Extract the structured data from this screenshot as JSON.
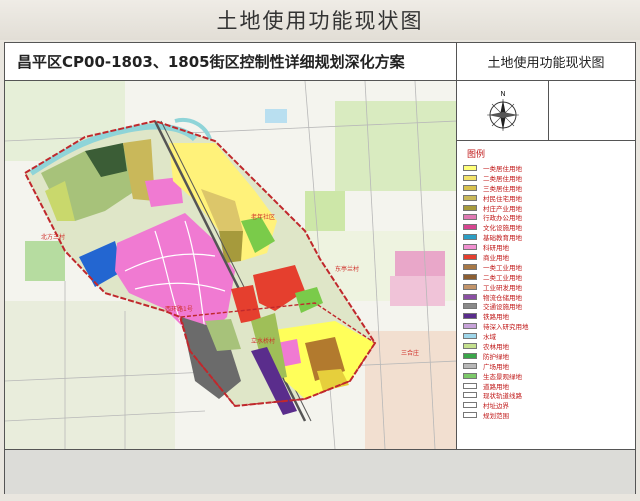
{
  "page_title": "土地使用功能现状图",
  "header": {
    "plan_title": "昌平区CP00-1803、1805街区控制性详细规划深化方案",
    "panel_title": "土地使用功能现状图"
  },
  "compass": {
    "north_letter": "N",
    "icon": "north-arrow-compass-icon"
  },
  "map": {
    "labels": [
      "北方三村",
      "西环路1号",
      "老年社区",
      "东亭兰村",
      "立水桥村",
      "三合庄"
    ]
  },
  "legend": {
    "title": "图例",
    "items": [
      {
        "label": "一类居住用地",
        "color": "#ffff7a"
      },
      {
        "label": "二类居住用地",
        "color": "#f2e26a"
      },
      {
        "label": "三类居住用地",
        "color": "#d7c14e"
      },
      {
        "label": "村民住宅用地",
        "color": "#c9b85a"
      },
      {
        "label": "村庄产业用地",
        "color": "#a69a3c"
      },
      {
        "label": "行政办公用地",
        "color": "#e07ab4"
      },
      {
        "label": "文化设施用地",
        "color": "#d64590"
      },
      {
        "label": "基础教育用地",
        "color": "#2c9ec4"
      },
      {
        "label": "科研用地",
        "color": "#f090d0"
      },
      {
        "label": "商业用地",
        "color": "#e53f2e"
      },
      {
        "label": "一类工业用地",
        "color": "#a77846"
      },
      {
        "label": "二类工业用地",
        "color": "#8c5e32"
      },
      {
        "label": "工业研发用地",
        "color": "#c2946a"
      },
      {
        "label": "物流仓储用地",
        "color": "#8a4fa3"
      },
      {
        "label": "交通设施用地",
        "color": "#8a8a8a"
      },
      {
        "label": "铁路用地",
        "color": "#5a2d8c"
      },
      {
        "label": "待深入研究用地",
        "color": "#c7a3d9"
      },
      {
        "label": "水域",
        "color": "#9fd6ea"
      },
      {
        "label": "农林用地",
        "color": "#c4e08f"
      },
      {
        "label": "防护绿地",
        "color": "#3aa64a"
      },
      {
        "label": "广场用地",
        "color": "#b8b8b8"
      },
      {
        "label": "生态景观绿地",
        "color": "#7cc96a"
      },
      {
        "label": "道路用地",
        "color": "#ffffff"
      },
      {
        "label": "现状轨道线路",
        "color": "#ffffff"
      },
      {
        "label": "村址边界",
        "color": "#ffffff"
      },
      {
        "label": "规划范围",
        "color": "#ffffff"
      }
    ]
  },
  "colors": {
    "boundary": "#c0282c",
    "river": "#8fd4d8",
    "background_green": "#cfe6b0"
  }
}
